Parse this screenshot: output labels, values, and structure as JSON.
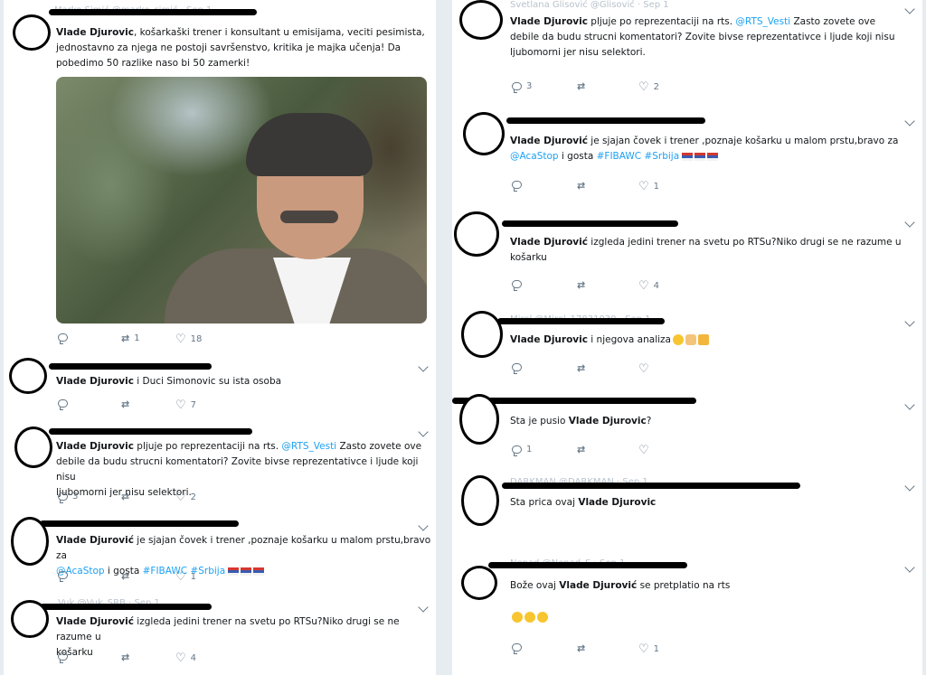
{
  "left_column": {
    "tweets": [
      {
        "faded_header": "Marko Simić @marko_simić · Sep 1",
        "paragraphs": [
          {
            "author": "Vlade Djurovic",
            "text": ", košarkaški trener i konsultant u emisijama,  veciti pesimista,"
          },
          {
            "text": "jednostavno za njega ne postoji savršenstvo, kritika je majka učenja! Da"
          },
          {
            "text": "pobedimo 50 razlike naso bi 50 zamerki!"
          }
        ],
        "image_description_icon": "photo",
        "actions": {
          "reply": "",
          "retweet": "1",
          "like": "18"
        }
      },
      {
        "paragraphs": [
          {
            "author": "Vlade Djurovic",
            "text": " i Duci Simonovic su ista osoba"
          }
        ],
        "actions": {
          "reply": "",
          "retweet": "",
          "like": "7"
        }
      },
      {
        "paragraphs": [
          {
            "author": "Vlade Djurovic",
            "text": " pljuje po reprezentaciji na rts. ",
            "link": "@RTS_Vesti",
            "after": "  Zasto zovete ove"
          },
          {
            "text": "debile da budu strucni komentatori? Zovite bivse reprezentativce i ljude koji nisu"
          },
          {
            "text": "ljubomorni jer nisu selektori."
          }
        ],
        "actions": {
          "reply": "3",
          "retweet": "",
          "like": "2"
        }
      },
      {
        "paragraphs": [
          {
            "author": "Vlade Djurović",
            "text": " je sjajan čovek i trener ,poznaje košarku u malom prstu,bravo za"
          },
          {
            "link": "@AcaStop",
            "text": " i gosta ",
            "hashtags": "#FIBAWC #Srbija"
          }
        ],
        "actions": {
          "reply": "",
          "retweet": "",
          "like": "1"
        }
      },
      {
        "faded_header": "Vuk @Vuk_SRB · Sep 1",
        "paragraphs": [
          {
            "author": "Vlade Djurović",
            "text": " izgleda jedini trener na svetu po RTSu?Niko drugi se ne razume u"
          },
          {
            "text": "košarku"
          }
        ],
        "actions": {
          "reply": "",
          "retweet": "",
          "like": "4"
        }
      }
    ]
  },
  "right_column": {
    "tweets": [
      {
        "faded_header": "Svetlana Glisović @Glisović · Sep 1",
        "paragraphs": [
          {
            "author": "Vlade Djurovic",
            "text": " pljuje po reprezentaciji na rts. ",
            "link": "@RTS_Vesti",
            "after": "  Zasto zovete ove"
          },
          {
            "text": "debile da budu strucni komentatori? Zovite bivse reprezentativce i ljude koji nisu"
          },
          {
            "text": "ljubomorni jer nisu selektori."
          }
        ],
        "actions": {
          "reply": "3",
          "retweet": "",
          "like": "2"
        }
      },
      {
        "paragraphs": [
          {
            "author": "Vlade Djurović",
            "text": " je sjajan čovek i trener ,poznaje košarku u malom prstu,bravo za"
          },
          {
            "link": "@AcaStop",
            "text": " i gosta ",
            "hashtags": "#FIBAWC #Srbija"
          }
        ],
        "actions": {
          "reply": "",
          "retweet": "",
          "like": "1"
        }
      },
      {
        "paragraphs": [
          {
            "author": "Vlade Djurović",
            "text": " izgleda jedini trener na svetu po RTSu?Niko drugi se ne razume u"
          },
          {
            "text": "košarku"
          }
        ],
        "actions": {
          "reply": "",
          "retweet": "",
          "like": "4"
        }
      },
      {
        "faded_header": "Mirel @Mirel_17831030 · Sep 1",
        "paragraphs": [
          {
            "author": "Vlade Djurovic",
            "text": " i njegova analiza"
          }
        ],
        "actions": {
          "reply": "",
          "retweet": "",
          "like": ""
        }
      },
      {
        "paragraphs": [
          {
            "text": "Sta je pusio ",
            "author_after": "Vlade Djurovic",
            "after": "?"
          }
        ],
        "actions": {
          "reply": "1",
          "retweet": "",
          "like": ""
        }
      },
      {
        "faded_header": "DARKMAN @DARKMAN · Sep 1",
        "paragraphs": [
          {
            "text": "Sta prica ovaj ",
            "author_after": "Vlade Djurovic"
          }
        ],
        "actions": {
          "reply": "",
          "retweet": "",
          "like": ""
        }
      },
      {
        "faded_header": "Nenad @Nenad_S · Sep 1",
        "paragraphs": [
          {
            "text": "Bože ovaj ",
            "author_after": "Vlade Djurović",
            "after": " se pretplatio na rts"
          }
        ],
        "actions": {
          "reply": "",
          "retweet": "",
          "like": "1"
        }
      }
    ]
  },
  "icons": {
    "reply": "reply-icon",
    "retweet": "retweet-icon",
    "like": "heart-icon",
    "more": "chevron-down-icon"
  },
  "colors": {
    "link": "#1da1f2",
    "action": "#657786",
    "background": "#e6ecf0"
  }
}
